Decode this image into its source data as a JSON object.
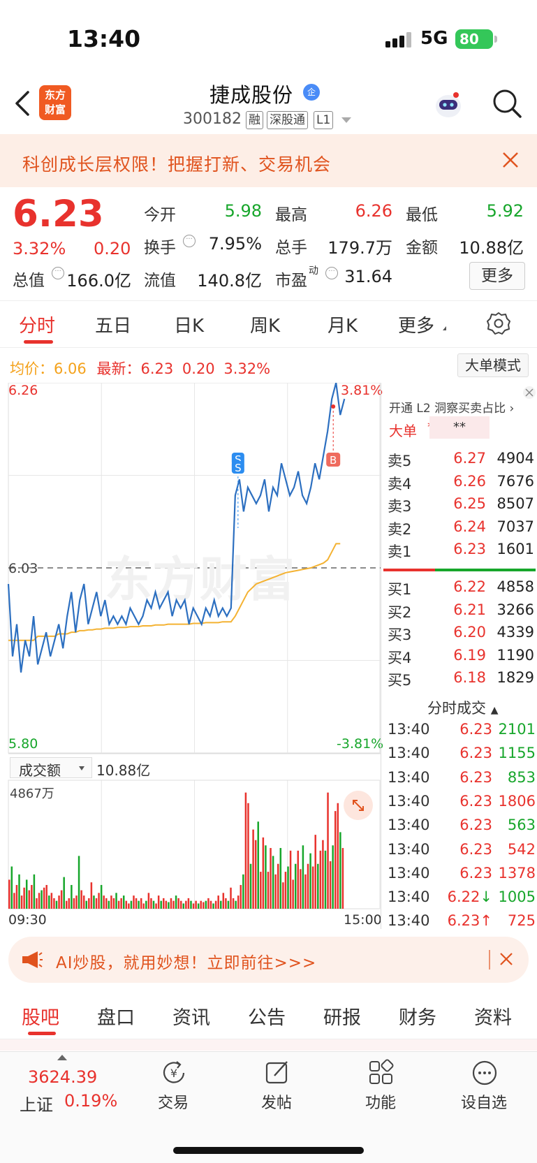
{
  "status": {
    "time": "13:40",
    "network": "5G",
    "battery": "80"
  },
  "header": {
    "logo_line1": "东方",
    "logo_line2": "财富",
    "stock_name": "捷成股份",
    "ent_badge": "企",
    "stock_code": "300182",
    "tags": [
      "融",
      "深股通",
      "L1"
    ]
  },
  "promo": {
    "text": "科创成长层权限！把握打新、交易机会"
  },
  "quote": {
    "price": "6.23",
    "change_pct": "3.32%",
    "change_val": "0.20",
    "fields": [
      {
        "label": "今开",
        "value": "5.98",
        "color": "#17a62b"
      },
      {
        "label": "最高",
        "value": "6.26",
        "color": "#e8322d"
      },
      {
        "label": "最低",
        "value": "5.92",
        "color": "#17a62b"
      },
      {
        "label": "换手",
        "value": "7.95%",
        "color": "#222222"
      },
      {
        "label": "总手",
        "value": "179.7万",
        "color": "#222222"
      },
      {
        "label": "金额",
        "value": "10.88亿",
        "color": "#222222"
      },
      {
        "label": "总值",
        "value": "166.0亿",
        "color": "#222222"
      },
      {
        "label": "流值",
        "value": "140.8亿",
        "color": "#222222"
      },
      {
        "label": "市盈",
        "value": "31.64",
        "color": "#222222"
      }
    ],
    "pe_sup": "动",
    "more": "更多"
  },
  "tabs": [
    "分时",
    "五日",
    "日K",
    "周K",
    "月K",
    "更多"
  ],
  "chart_info": {
    "avg_label": "均价：",
    "avg_value": "6.06",
    "latest_label": "最新：",
    "latest_value": "6.23",
    "latest_change": "0.20",
    "latest_pct": "3.32%",
    "big_order_mode": "大单模式"
  },
  "chart_data": {
    "type": "line",
    "x_start": "09:30",
    "x_end": "15:00",
    "y_max_label": "6.26",
    "y_min_label": "5.80",
    "pct_max_label": "3.81%",
    "pct_min_label": "-3.81%",
    "prev_close_label": "6.03",
    "ylim": [
      5.8,
      6.26
    ],
    "series": [],
    "price_values": [
      6.01,
      5.92,
      5.96,
      5.9,
      5.94,
      5.92,
      5.97,
      5.91,
      5.93,
      5.95,
      5.92,
      5.94,
      5.96,
      5.93,
      5.97,
      6.0,
      5.95,
      5.99,
      6.01,
      5.96,
      5.98,
      6.0,
      5.97,
      5.99,
      5.96,
      5.97,
      5.96,
      5.97,
      5.96,
      5.98,
      5.97,
      5.96,
      5.97,
      5.99,
      5.98,
      6.0,
      5.98,
      5.99,
      6.0,
      5.97,
      5.99,
      5.98,
      5.99,
      5.96,
      5.98,
      5.97,
      5.96,
      5.98,
      5.97,
      5.99,
      5.97,
      5.98,
      5.97,
      5.98,
      6.12,
      6.14,
      6.1,
      6.13,
      6.12,
      6.11,
      6.12,
      6.14,
      6.1,
      6.13,
      6.12,
      6.16,
      6.14,
      6.12,
      6.13,
      6.15,
      6.12,
      6.11,
      6.13,
      6.16,
      6.14,
      6.17,
      6.2,
      6.24,
      6.26,
      6.22,
      6.24
    ],
    "avg_values": [
      5.94,
      5.94,
      5.94,
      5.94,
      5.94,
      5.94,
      5.94,
      5.945,
      5.945,
      5.945,
      5.945,
      5.945,
      5.948,
      5.948,
      5.948,
      5.95,
      5.95,
      5.952,
      5.952,
      5.953,
      5.953,
      5.954,
      5.954,
      5.955,
      5.955,
      5.955,
      5.956,
      5.956,
      5.956,
      5.957,
      5.957,
      5.957,
      5.958,
      5.958,
      5.958,
      5.959,
      5.959,
      5.959,
      5.96,
      5.96,
      5.96,
      5.96,
      5.96,
      5.96,
      5.961,
      5.961,
      5.961,
      5.962,
      5.962,
      5.962,
      5.962,
      5.963,
      5.963,
      5.963,
      5.97,
      5.98,
      5.99,
      6.0,
      6.005,
      6.01,
      6.012,
      6.014,
      6.016,
      6.018,
      6.02,
      6.022,
      6.024,
      6.025,
      6.026,
      6.027,
      6.028,
      6.029,
      6.03,
      6.032,
      6.034,
      6.036,
      6.04,
      6.05,
      6.06,
      6.06
    ],
    "volume_label": "成交额",
    "volume_total": "10.88亿",
    "volume_max_label": "4867万",
    "volume_ylim": [
      0,
      4867
    ],
    "volumes": [
      1100,
      1600,
      600,
      900,
      1300,
      500,
      800,
      1100,
      700,
      900,
      1300,
      400,
      600,
      700,
      800,
      900,
      500,
      600,
      400,
      300,
      500,
      700,
      1200,
      300,
      400,
      900,
      400,
      500,
      2000,
      700,
      500,
      300,
      400,
      1000,
      500,
      400,
      600,
      900,
      500,
      400,
      300,
      500,
      400,
      600,
      300,
      400,
      500,
      300,
      200,
      300,
      500,
      400,
      300,
      400,
      200,
      300,
      600,
      400,
      300,
      200,
      500,
      300,
      400,
      300,
      250,
      400,
      300,
      500,
      400,
      300,
      200,
      300,
      400,
      300,
      200,
      300,
      200,
      300,
      250,
      300,
      400,
      300,
      200,
      300,
      500,
      300,
      600,
      400,
      300,
      800,
      400,
      300,
      500,
      900,
      1300,
      4400,
      4000,
      1700,
      3000,
      2600,
      3300,
      1400,
      2700,
      2400,
      1400,
      2300,
      2000,
      1300,
      1700,
      2300,
      1000,
      1400,
      1600,
      2200,
      1100,
      1700,
      2200,
      1500,
      2400,
      1300,
      1700,
      2100,
      1600,
      2800,
      1700,
      2200,
      2600,
      2200,
      4400,
      1800,
      2400,
      3700,
      4000,
      2900,
      2300
    ],
    "markers": [
      {
        "label": "S"
      },
      {
        "label": "S"
      },
      {
        "label": "B"
      }
    ]
  },
  "orderbook": {
    "l2_text": "开通 L2 洞察买卖占比",
    "big_order_label": "大单",
    "big_order_stars": "**",
    "big_order_hidden": "**",
    "asks": [
      {
        "label": "卖5",
        "price": "6.27",
        "volume": "4904"
      },
      {
        "label": "卖4",
        "price": "6.26",
        "volume": "7676"
      },
      {
        "label": "卖3",
        "price": "6.25",
        "volume": "8507"
      },
      {
        "label": "卖2",
        "price": "6.24",
        "volume": "7037"
      },
      {
        "label": "卖1",
        "price": "6.23",
        "volume": "1601"
      }
    ],
    "bids": [
      {
        "label": "买1",
        "price": "6.22",
        "volume": "4858"
      },
      {
        "label": "买2",
        "price": "6.21",
        "volume": "3266"
      },
      {
        "label": "买3",
        "price": "6.20",
        "volume": "4339"
      },
      {
        "label": "买4",
        "price": "6.19",
        "volume": "1190"
      },
      {
        "label": "买5",
        "price": "6.18",
        "volume": "1829"
      }
    ]
  },
  "trades": {
    "title": "分时成交",
    "rows": [
      {
        "time": "13:40",
        "price": "6.23",
        "volume": "2101",
        "vcolor": "#17a62b",
        "arrow": ""
      },
      {
        "time": "13:40",
        "price": "6.23",
        "volume": "1155",
        "vcolor": "#17a62b",
        "arrow": ""
      },
      {
        "time": "13:40",
        "price": "6.23",
        "volume": "853",
        "vcolor": "#17a62b",
        "arrow": ""
      },
      {
        "time": "13:40",
        "price": "6.23",
        "volume": "1806",
        "vcolor": "#e8322d",
        "arrow": ""
      },
      {
        "time": "13:40",
        "price": "6.23",
        "volume": "563",
        "vcolor": "#17a62b",
        "arrow": ""
      },
      {
        "time": "13:40",
        "price": "6.23",
        "volume": "542",
        "vcolor": "#e8322d",
        "arrow": ""
      },
      {
        "time": "13:40",
        "price": "6.23",
        "volume": "1378",
        "vcolor": "#e8322d",
        "arrow": ""
      },
      {
        "time": "13:40",
        "price": "6.22",
        "volume": "1005",
        "vcolor": "#17a62b",
        "arrow": "↓"
      },
      {
        "time": "13:40",
        "price": "6.23",
        "volume": "725",
        "vcolor": "#e8322d",
        "arrow": "↑"
      }
    ]
  },
  "ai_banner": {
    "text": "AI炒股，就用妙想！立即前往>>>"
  },
  "bottom_tabs": [
    "股吧",
    "盘口",
    "资讯",
    "公告",
    "研报",
    "财务",
    "资料"
  ],
  "bottom_bar": {
    "index_value": "3624.39",
    "index_name": "上证",
    "index_pct": "0.19%",
    "items": [
      "交易",
      "发帖",
      "功能",
      "设自选"
    ]
  },
  "colors": {
    "up": "#e8322d",
    "down": "#17a62b",
    "price_line": "#2c6fc0",
    "avg_line": "#f4b232",
    "accent": "#f05a22"
  }
}
